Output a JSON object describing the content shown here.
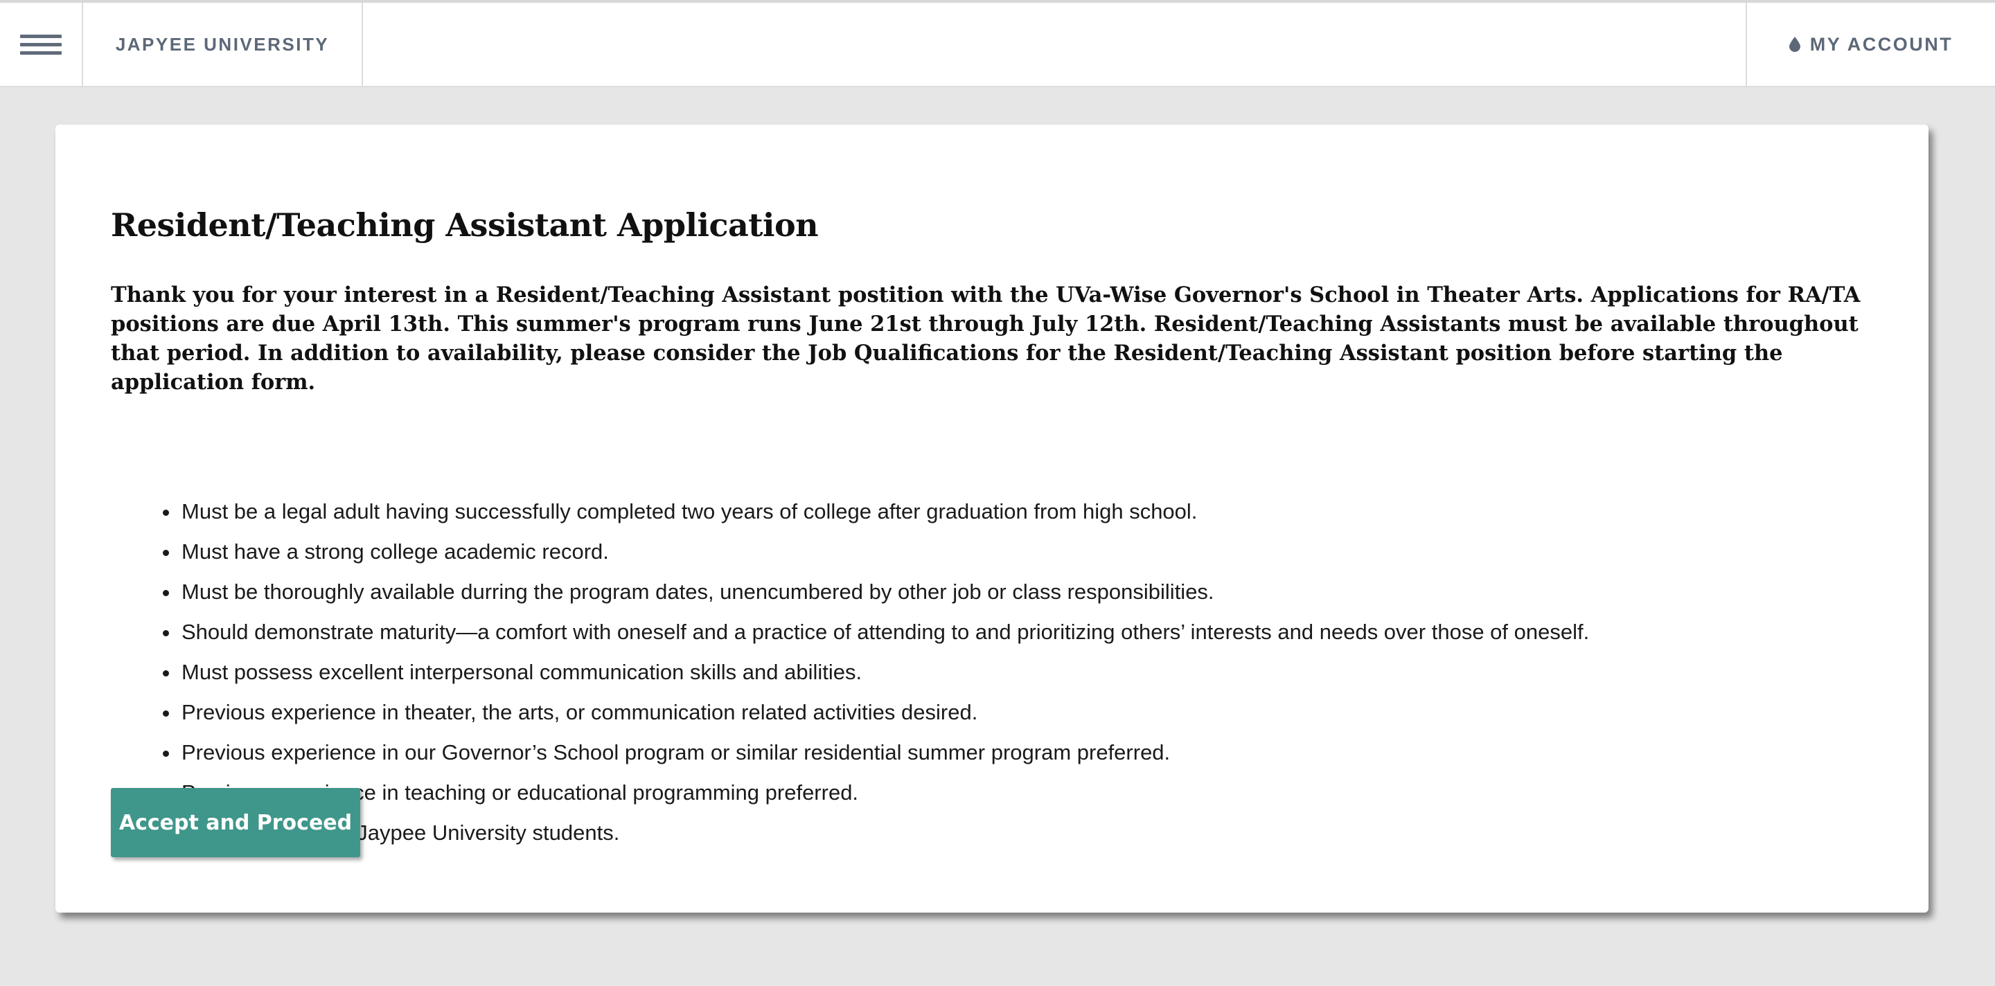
{
  "header": {
    "brand": "JAPYEE UNIVERSITY",
    "account_label": "MY ACCOUNT",
    "menu_icon": "hamburger-menu-icon",
    "account_icon": "drop-icon"
  },
  "main": {
    "title": "Resident/Teaching Assistant Application",
    "intro": "Thank you for your interest in a Resident/Teaching Assistant postition with the UVa-Wise Governor's School in Theater Arts. Applications for RA/TA positions are due April 13th. This summer's program runs June 21st through July 12th. Resident/Teaching Assistants must be available throughout that period. In addition to availability, please consider the Job Qualifications for the Resident/Teaching Assistant position before starting the application form.",
    "qualifications": [
      "Must be a legal adult having successfully completed two years of college after graduation from high school.",
      "Must have a strong college academic record.",
      "Must be thoroughly available durring the program dates, unencumbered by other job or class responsibilities.",
      "Should demonstrate maturity—a comfort with oneself and a practice of attending to and prioritizing others’ interests and needs over those of oneself.",
      "Must possess excellent interpersonal communication skills and abilities.",
      "Previous experience in theater, the arts, or communication related activities desired.",
      "Previous experience in our Governor’s School program or similar residential summer program preferred.",
      "Previous experience in teaching or educational programming preferred.",
      "Priority is given to Jaypee University students."
    ],
    "accept_button": "Accept and Proceed"
  },
  "colors": {
    "accent": "#3f968a",
    "header_text": "#5c6878",
    "background": "#e6e6e6"
  }
}
